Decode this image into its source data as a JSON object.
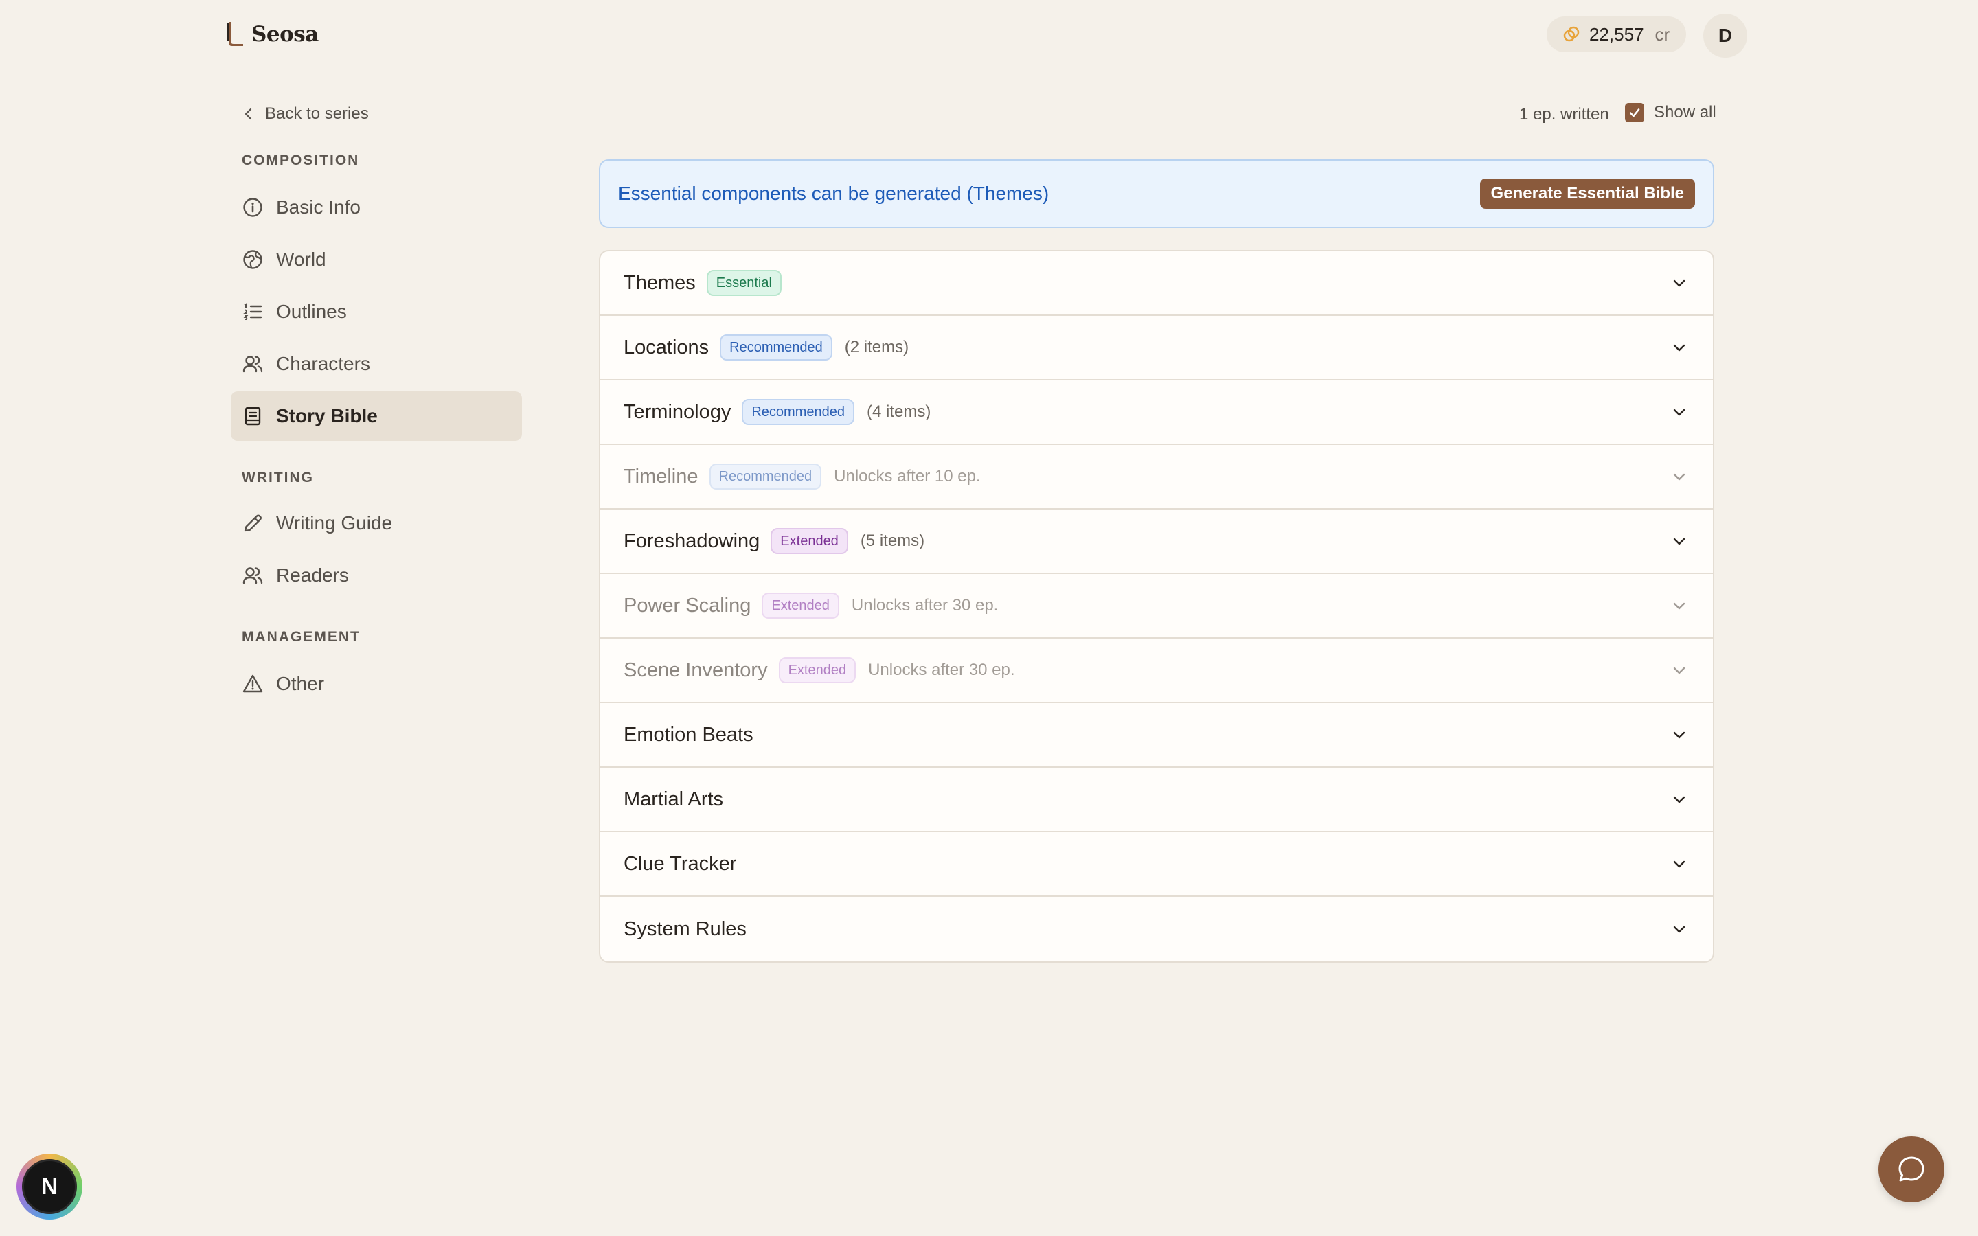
{
  "app": {
    "name": "Seosa"
  },
  "header": {
    "credits_value": "22,557",
    "credits_unit": "cr",
    "avatar_initial": "D"
  },
  "sidebar": {
    "back_label": "Back to series",
    "sections": [
      {
        "label": "COMPOSITION",
        "items": [
          {
            "label": "Basic Info",
            "icon": "info-icon"
          },
          {
            "label": "World",
            "icon": "globe-icon"
          },
          {
            "label": "Outlines",
            "icon": "list-icon"
          },
          {
            "label": "Characters",
            "icon": "users-icon"
          },
          {
            "label": "Story Bible",
            "icon": "book-icon",
            "active": true
          }
        ]
      },
      {
        "label": "WRITING",
        "items": [
          {
            "label": "Writing Guide",
            "icon": "pen-icon"
          },
          {
            "label": "Readers",
            "icon": "users-icon"
          }
        ]
      },
      {
        "label": "MANAGEMENT",
        "items": [
          {
            "label": "Other",
            "icon": "warning-icon"
          }
        ]
      }
    ]
  },
  "status": {
    "episodes": "1 ep. written",
    "show_all_label": "Show all",
    "show_all_checked": true
  },
  "banner": {
    "text": "Essential components can be generated (Themes)",
    "button_label": "Generate Essential Bible"
  },
  "components": [
    {
      "title": "Themes",
      "badge": "Essential",
      "badge_type": "essential",
      "meta": "",
      "locked": false
    },
    {
      "title": "Locations",
      "badge": "Recommended",
      "badge_type": "recommended",
      "meta": "(2 items)",
      "locked": false
    },
    {
      "title": "Terminology",
      "badge": "Recommended",
      "badge_type": "recommended",
      "meta": "(4 items)",
      "locked": false
    },
    {
      "title": "Timeline",
      "badge": "Recommended",
      "badge_type": "recommended",
      "meta": "Unlocks after 10 ep.",
      "locked": true
    },
    {
      "title": "Foreshadowing",
      "badge": "Extended",
      "badge_type": "extended",
      "meta": "(5 items)",
      "locked": false
    },
    {
      "title": "Power Scaling",
      "badge": "Extended",
      "badge_type": "extended",
      "meta": "Unlocks after 30 ep.",
      "locked": true
    },
    {
      "title": "Scene Inventory",
      "badge": "Extended",
      "badge_type": "extended",
      "meta": "Unlocks after 30 ep.",
      "locked": true
    },
    {
      "title": "Emotion Beats",
      "badge": "",
      "badge_type": "",
      "meta": "",
      "locked": false
    },
    {
      "title": "Martial Arts",
      "badge": "",
      "badge_type": "",
      "meta": "",
      "locked": false
    },
    {
      "title": "Clue Tracker",
      "badge": "",
      "badge_type": "",
      "meta": "",
      "locked": false
    },
    {
      "title": "System Rules",
      "badge": "",
      "badge_type": "",
      "meta": "",
      "locked": false
    }
  ],
  "floating": {
    "n_badge_letter": "N"
  },
  "colors": {
    "accent": "#8a5a3c",
    "background": "#f5f1ea",
    "banner_text": "#1d5bb8"
  }
}
